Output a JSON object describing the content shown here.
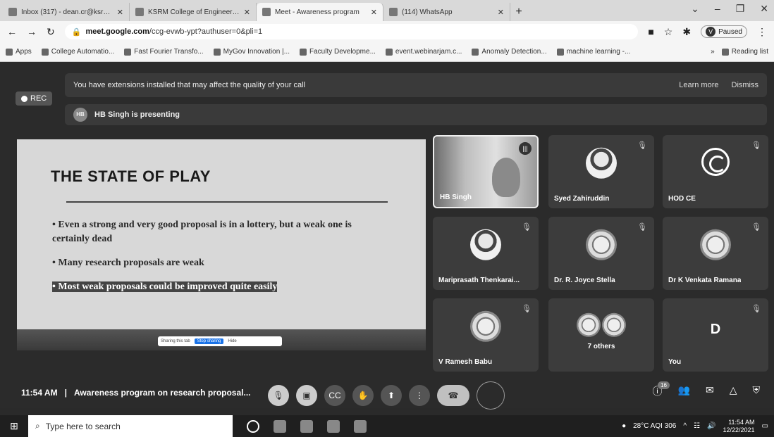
{
  "browser": {
    "tabs": [
      {
        "title": "Inbox (317) - dean.cr@ksrmce.ac"
      },
      {
        "title": "KSRM College of Engineering - "
      },
      {
        "title": "Meet - Awareness program"
      },
      {
        "title": "(114) WhatsApp"
      }
    ],
    "url_host": "meet.google.com",
    "url_path": "/ccg-evwb-ypt?authuser=0&pli=1",
    "profile_initial": "V",
    "profile_status": "Paused",
    "bookmarks": [
      "Apps",
      "College Automatio...",
      "Fast Fourier Transfo...",
      "MyGov Innovation |...",
      "Faculty Developme...",
      "event.webinarjam.c...",
      "Anomaly Detection...",
      "machine learning -..."
    ],
    "reading_list": "Reading list"
  },
  "meet": {
    "banner_text": "You have extensions installed that may affect the quality of your call",
    "learn_more": "Learn more",
    "dismiss": "Dismiss",
    "rec_label": "REC",
    "presenter_initials": "HB",
    "presenting_text": "HB Singh is presenting",
    "slide": {
      "title": "THE STATE OF PLAY",
      "bullets": [
        "• Even a strong and very good proposal is in a lottery, but a weak one is certainly dead",
        "• Many research proposals are weak",
        "• Most weak proposals could be improved quite easily"
      ],
      "stop_label": "Stop sharing",
      "hide_label": "Hide"
    },
    "participants": [
      {
        "name": "HB Singh"
      },
      {
        "name": "Syed Zahiruddin"
      },
      {
        "name": "HOD CE"
      },
      {
        "name": "Mariprasath Thenkarai..."
      },
      {
        "name": "Dr. R. Joyce Stella"
      },
      {
        "name": "Dr K Venkata Ramana"
      },
      {
        "name": "V Ramesh Babu"
      },
      {
        "name": "7 others"
      },
      {
        "name": "You",
        "initial": "D"
      }
    ],
    "time": "11:54 AM",
    "meeting_title": "Awareness program on research proposal...",
    "people_count": "16"
  },
  "taskbar": {
    "search_placeholder": "Type here to search",
    "weather": "28°C AQI 306",
    "clock_time": "11:54 AM",
    "clock_date": "12/22/2021"
  }
}
